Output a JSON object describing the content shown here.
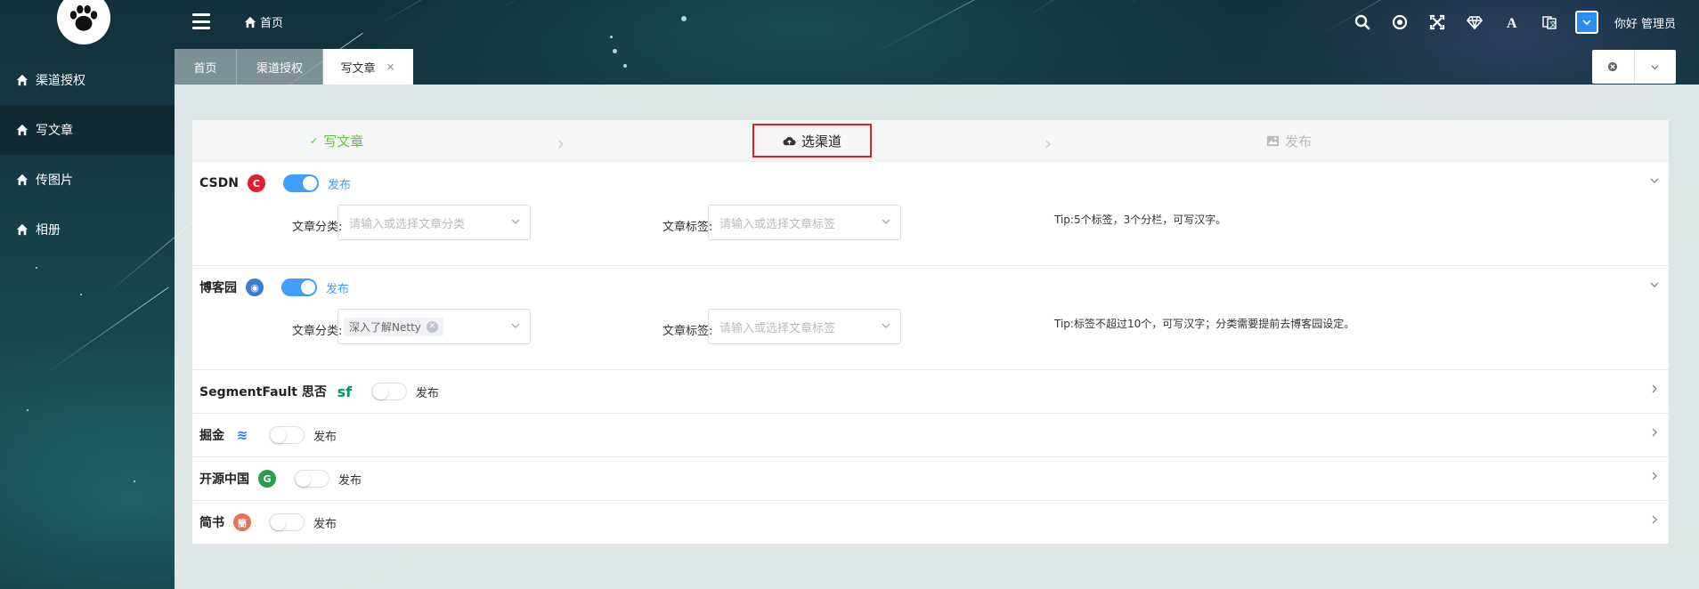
{
  "header": {
    "home_label": "首页",
    "user_label": "你好 管理员",
    "icons": [
      "search-icon",
      "target-icon",
      "fullscreen-icon",
      "diamond-icon",
      "font-icon",
      "translate-icon"
    ]
  },
  "sidebar": {
    "items": [
      {
        "label": "渠道授权",
        "icon": "home-icon"
      },
      {
        "label": "写文章",
        "icon": "home-icon"
      },
      {
        "label": "传图片",
        "icon": "home-icon"
      },
      {
        "label": "相册",
        "icon": "home-icon"
      }
    ]
  },
  "tabs": [
    {
      "label": "首页"
    },
    {
      "label": "渠道授权"
    },
    {
      "label": "写文章",
      "close": "×"
    }
  ],
  "steps": [
    {
      "label": "写文章",
      "state": "done",
      "mark": "✓"
    },
    {
      "label": "选渠道",
      "state": "current"
    },
    {
      "label": "发布",
      "state": "pending"
    }
  ],
  "channels": [
    {
      "name": "CSDN",
      "logo": "C",
      "logo_color": "#e0202c",
      "enabled": true,
      "publish_label": "发布",
      "expanded": true,
      "category_label": "文章分类:",
      "category_placeholder": "请输入或选择文章分类",
      "tag_label": "文章标签:",
      "tag_placeholder": "请输入或选择文章标签",
      "tip": "Tip:5个标签，3个分栏，可写汉字。"
    },
    {
      "name": "博客园",
      "logo": "◉",
      "logo_color": "#3c7bd3",
      "enabled": true,
      "publish_label": "发布",
      "expanded": true,
      "category_label": "文章分类:",
      "category_value": "深入了解Netty",
      "tag_label": "文章标签:",
      "tag_placeholder": "请输入或选择文章标签",
      "tip": "Tip:标签不超过10个，可写汉字；分类需要提前去博客园设定。"
    },
    {
      "name": "SegmentFault 思否",
      "logo": "sf",
      "logo_color": "#009a61",
      "enabled": false,
      "publish_label": "发布"
    },
    {
      "name": "掘金",
      "logo": "≋",
      "logo_color": "#1e80ff",
      "enabled": false,
      "publish_label": "发布"
    },
    {
      "name": "开源中国",
      "logo": "G",
      "logo_color": "#2a9d4a",
      "enabled": false,
      "publish_label": "发布"
    },
    {
      "name": "简书",
      "logo": "簡",
      "logo_color": "#ea6f5a",
      "enabled": false,
      "publish_label": "发布"
    }
  ],
  "colors": {
    "accent": "#409eff",
    "success": "#67c23a",
    "highlight_border": "#e02020"
  }
}
